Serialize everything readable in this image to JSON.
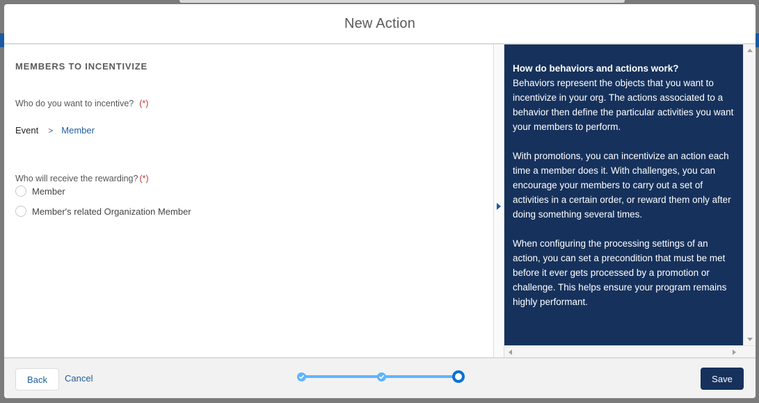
{
  "modal": {
    "title": "New Action"
  },
  "form": {
    "section_title": "MEMBERS TO INCENTIVIZE",
    "question_incentive": "Who do you want to incentive?",
    "required_marker": "(*)",
    "path": {
      "root": "Event",
      "separator": ">",
      "leaf": "Member"
    },
    "question_reward": "Who will receive the rewarding?",
    "reward_options": [
      {
        "label": "Member",
        "selected": false
      },
      {
        "label": "Member's related Organization Member",
        "selected": false
      }
    ]
  },
  "help": {
    "heading": "How do behaviors and actions work?",
    "paragraph_1": "Behaviors represent the objects that you want to incentivize in your org. The actions associated to a behavior then define the particular activities you want your members to perform.",
    "paragraph_2": "With promotions, you can incentivize an action each time a member does it. With challenges, you can encourage your members to carry out a set of activities in a certain order, or reward them only after doing something several times.",
    "paragraph_3": "When configuring the processing settings of an action, you can set a precondition that must be met before it ever gets processed by a promotion or challenge. This helps ensure your program remains highly performant."
  },
  "footer": {
    "back_label": "Back",
    "cancel_label": "Cancel",
    "save_label": "Save",
    "steps": [
      {
        "state": "complete"
      },
      {
        "state": "complete"
      },
      {
        "state": "current"
      }
    ]
  },
  "colors": {
    "brand_navy": "#16325c",
    "link_blue": "#1f5d9e",
    "required_red": "#c23934",
    "step_light": "#5eb4ff",
    "step_active": "#0b6fd6"
  },
  "icons": {
    "panel_toggle": "chevron-right-icon",
    "step_complete": "check-icon",
    "step_current": "ring-icon"
  }
}
